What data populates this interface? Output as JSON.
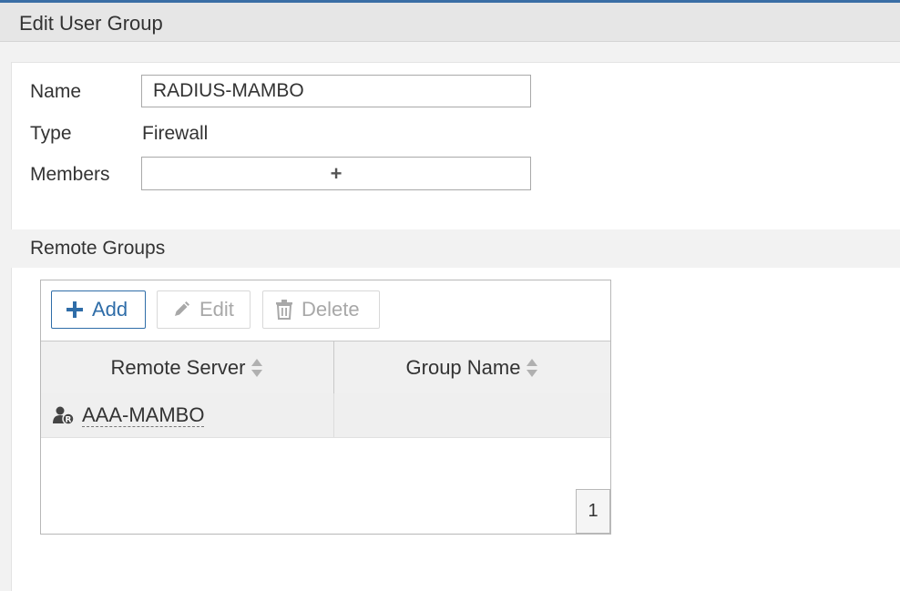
{
  "header": {
    "title": "Edit User Group"
  },
  "form": {
    "name_label": "Name",
    "name_value": "RADIUS-MAMBO",
    "type_label": "Type",
    "type_value": "Firewall",
    "members_label": "Members",
    "members_add_icon": "+"
  },
  "remote_groups": {
    "title": "Remote Groups",
    "toolbar": {
      "add_label": "Add",
      "edit_label": "Edit",
      "delete_label": "Delete"
    },
    "columns": [
      "Remote Server",
      "Group Name"
    ],
    "rows": [
      {
        "remote_server": "AAA-MAMBO",
        "group_name": ""
      }
    ],
    "page_number": "1"
  },
  "colors": {
    "accent": "#2f6da8",
    "top_line": "#3a6ea5",
    "disabled": "#a8a8a8"
  },
  "icons": {
    "add": "plus-icon",
    "edit": "pencil-icon",
    "delete": "trash-icon",
    "sort": "sort-icon",
    "server": "radius-server-icon"
  }
}
